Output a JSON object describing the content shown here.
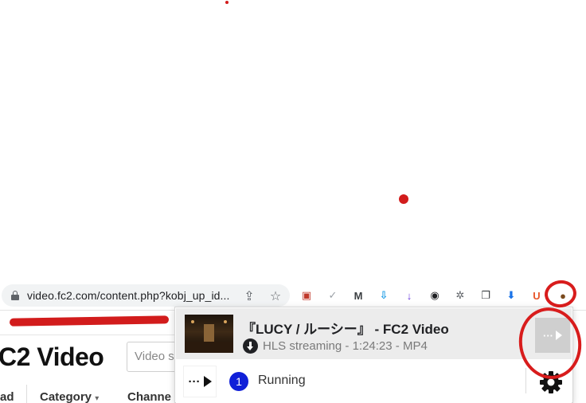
{
  "browser": {
    "url": "video.fc2.com/content.php?kobj_up_id...",
    "share_icon": "share-icon",
    "bookmark_icon": "star-icon",
    "extensions": [
      {
        "name": "gallery-extension-icon",
        "glyph": "▣",
        "color": "#c0392b"
      },
      {
        "name": "check-extension-icon",
        "glyph": "✓",
        "color": "#9aa0a6"
      },
      {
        "name": "m-extension-icon",
        "glyph": "M",
        "color": "#3c4043"
      },
      {
        "name": "download-blue-extension-icon",
        "glyph": "⇩",
        "color": "#1a9be6"
      },
      {
        "name": "arrow-down-purple-extension-icon",
        "glyph": "↓",
        "color": "#6c3ce0"
      },
      {
        "name": "vd-extension-icon",
        "glyph": "◉",
        "color": "#202124"
      },
      {
        "name": "aperture-extension-icon",
        "glyph": "✲",
        "color": "#5f6368"
      },
      {
        "name": "copy-extension-icon",
        "glyph": "❐",
        "color": "#3c4043"
      },
      {
        "name": "download-box-extension-icon",
        "glyph": "⬇",
        "color": "#1a73e8"
      },
      {
        "name": "u-extension-icon",
        "glyph": "U",
        "color": "#e8562a"
      },
      {
        "name": "video-downloader-extension-icon",
        "glyph": "●",
        "color": "#7a4a1d"
      }
    ]
  },
  "page": {
    "logo": "C2 Video",
    "search_placeholder": "Video s",
    "nav": [
      "ad",
      "Category",
      "Channe"
    ]
  },
  "popup": {
    "item": {
      "title": "『LUCY / ルーシー』 - FC2 Video",
      "type": "HLS streaming",
      "duration": "1:24:23",
      "format": "MP4",
      "action_label": "···"
    },
    "status": {
      "run_label": "···",
      "count": "1",
      "text": "Running",
      "settings_icon": "gear-icon"
    }
  },
  "colors": {
    "annotation_red": "#d81c1c",
    "badge_blue": "#1020d8"
  }
}
